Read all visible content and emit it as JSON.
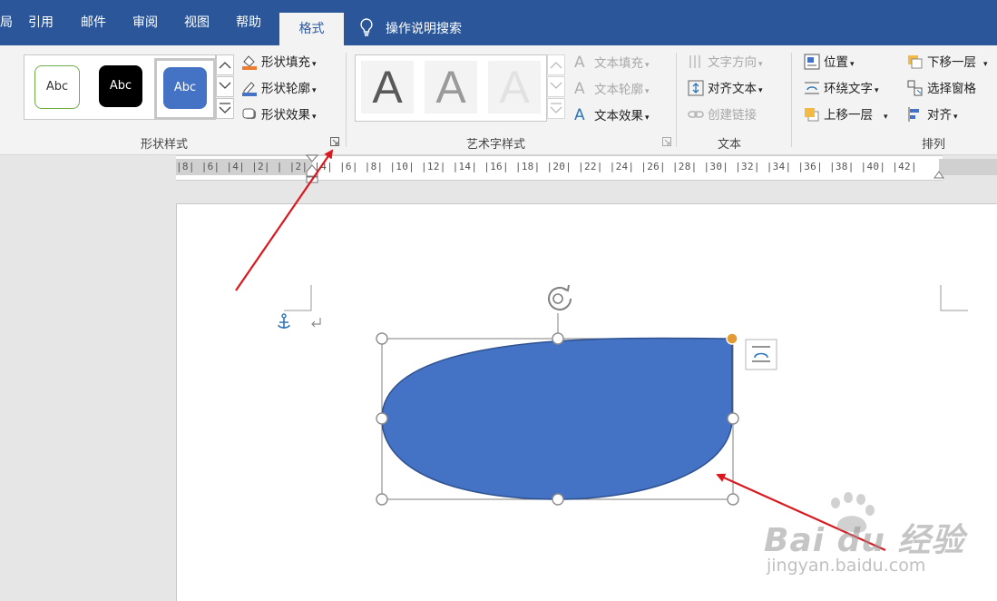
{
  "tabs": [
    {
      "label": "局"
    },
    {
      "label": "引用"
    },
    {
      "label": "邮件"
    },
    {
      "label": "审阅"
    },
    {
      "label": "视图"
    },
    {
      "label": "帮助"
    }
  ],
  "active_tab": "格式",
  "tell_me": "操作说明搜索",
  "shape_styles": {
    "presets": [
      "Abc",
      "Abc",
      "Abc"
    ],
    "fill": "形状填充",
    "outline": "形状轮廓",
    "effects": "形状效果",
    "group_label": "形状样式"
  },
  "wordart": {
    "letters": [
      "A",
      "A",
      "A"
    ],
    "text_fill": "文本填充",
    "text_outline": "文本轮廓",
    "text_effects": "文本效果",
    "group_label": "艺术字样式"
  },
  "text_group": {
    "direction": "文字方向",
    "align": "对齐文本",
    "link": "创建链接",
    "group_label": "文本"
  },
  "arrange": {
    "position": "位置",
    "wrap": "环绕文字",
    "bring_forward": "上移一层",
    "send_backward": "下移一层",
    "selection_pane": "选择窗格",
    "align": "对齐",
    "group_label": "排列"
  },
  "ruler": "|8|  |6|  |4|  |2|  |  |2|  |4|  |6|  |8|  |10| |12| |14| |16| |18| |20| |22| |24| |26| |28| |30| |32| |34| |36| |38| |40| |42|",
  "colors": {
    "title_bar": "#2b579a",
    "shape_fill": "#4472c4",
    "shape_outline": "#2f528f",
    "handle_adjust": "#e39b32",
    "arrow": "#d9191f"
  },
  "watermark": {
    "text": "Bai du 经验",
    "url": "jingyan.baidu.com"
  }
}
